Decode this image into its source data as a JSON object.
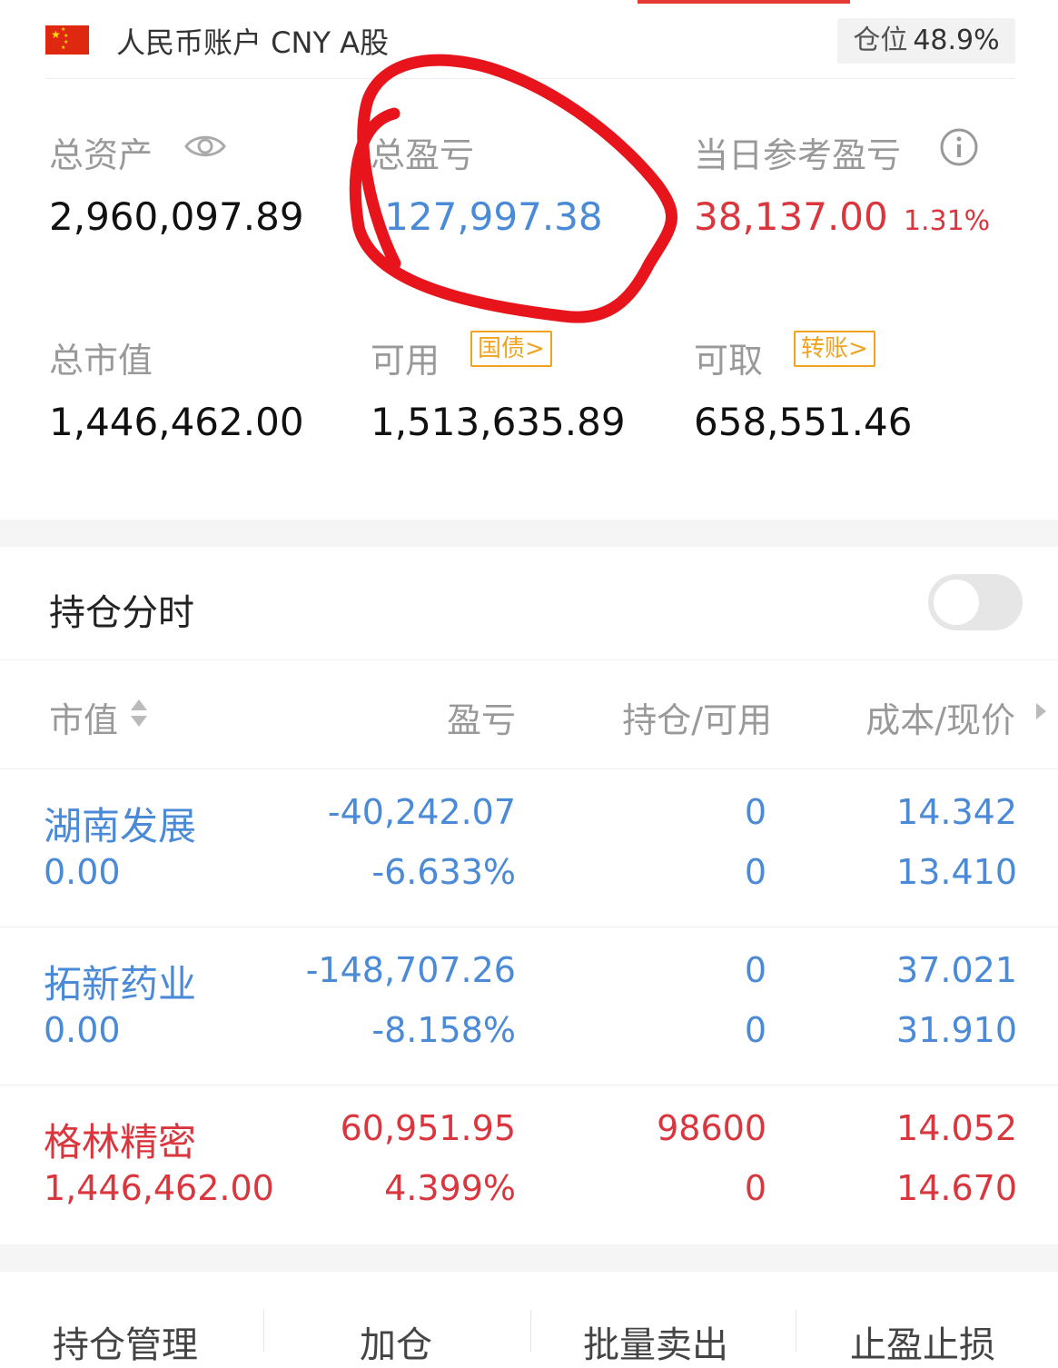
{
  "account": {
    "title": "人民币账户 CNY A股",
    "position_label": "仓位",
    "position_value": "48.9%"
  },
  "summary": {
    "total_assets_label": "总资产",
    "total_assets_value": "2,960,097.89",
    "total_pnl_label": "总盈亏",
    "total_pnl_value": "-127,997.38",
    "daily_pnl_label": "当日参考盈亏",
    "daily_pnl_value": "38,137.00",
    "daily_pnl_pct": "1.31%",
    "market_value_label": "总市值",
    "market_value_value": "1,446,462.00",
    "available_label": "可用",
    "available_tag": "国债>",
    "available_value": "1,513,635.89",
    "withdrawable_label": "可取",
    "withdrawable_tag": "转账>",
    "withdrawable_value": "658,551.46"
  },
  "timeshare": {
    "label": "持仓分时",
    "enabled": false
  },
  "table": {
    "headers": [
      "市值",
      "盈亏",
      "持仓/可用",
      "成本/现价"
    ],
    "rows": [
      {
        "name": "湖南发展",
        "market_value": "0.00",
        "pnl": "-40,242.07",
        "pnl_pct": "-6.633%",
        "hold": "0",
        "avail": "0",
        "cost": "14.342",
        "price": "13.410",
        "color": "#4a8ad6"
      },
      {
        "name": "拓新药业",
        "market_value": "0.00",
        "pnl": "-148,707.26",
        "pnl_pct": "-8.158%",
        "hold": "0",
        "avail": "0",
        "cost": "37.021",
        "price": "31.910",
        "color": "#4a8ad6"
      },
      {
        "name": "格林精密",
        "market_value": "1,446,462.00",
        "pnl": "60,951.95",
        "pnl_pct": "4.399%",
        "hold": "98600",
        "avail": "0",
        "cost": "14.052",
        "price": "14.670",
        "color": "#d9363e"
      }
    ]
  },
  "bottom_bar": [
    "持仓管理",
    "加仓",
    "批量卖出",
    "止盈止损"
  ],
  "colors": {
    "accent_red": "#e53935",
    "loss_blue": "#4a8ad6",
    "gain_red": "#d9363e",
    "tag_orange": "#f0a31e"
  }
}
